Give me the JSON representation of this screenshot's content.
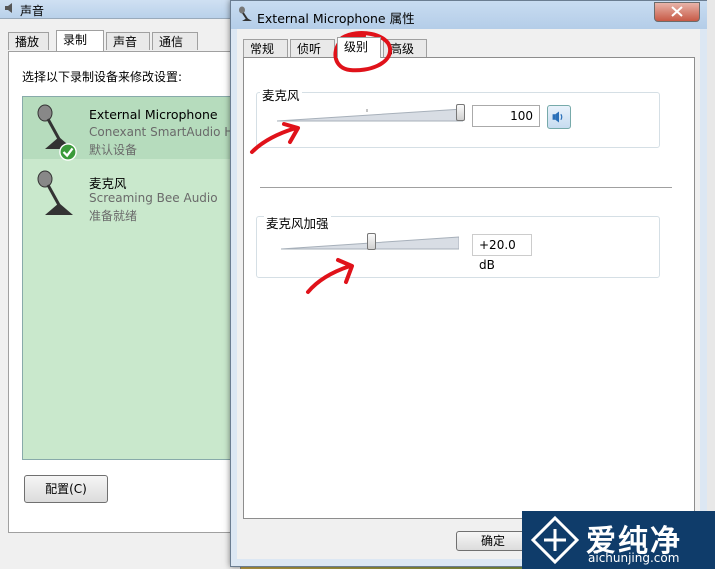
{
  "sound_window": {
    "title": "声音",
    "tabs": [
      "播放",
      "录制",
      "声音",
      "通信"
    ],
    "selected_tab": "录制",
    "instruction": "选择以下录制设备来修改设置:",
    "devices": [
      {
        "name": "External Microphone",
        "driver": "Conexant SmartAudio HD",
        "status": "默认设备",
        "default": true
      },
      {
        "name": "麦克风",
        "driver": "Screaming Bee Audio",
        "status": "准备就绪",
        "default": false
      }
    ],
    "configure_button": "配置(C)"
  },
  "properties_dialog": {
    "title": "External Microphone 属性",
    "tabs": [
      "常规",
      "侦听",
      "级别",
      "高级"
    ],
    "selected_tab": "级别",
    "microphone": {
      "label": "麦克风",
      "value": "100",
      "level": 1.0
    },
    "boost": {
      "label": "麦克风加强",
      "value": "+20.0 dB",
      "level": 0.5
    },
    "ok_button": "确定"
  },
  "watermark": {
    "brand": "爱纯净",
    "url": "aichunjing.com"
  },
  "colors": {
    "device_list": "#c9e8cc",
    "annotation": "#e0121a",
    "logo_bg": "#0f3c6a"
  }
}
